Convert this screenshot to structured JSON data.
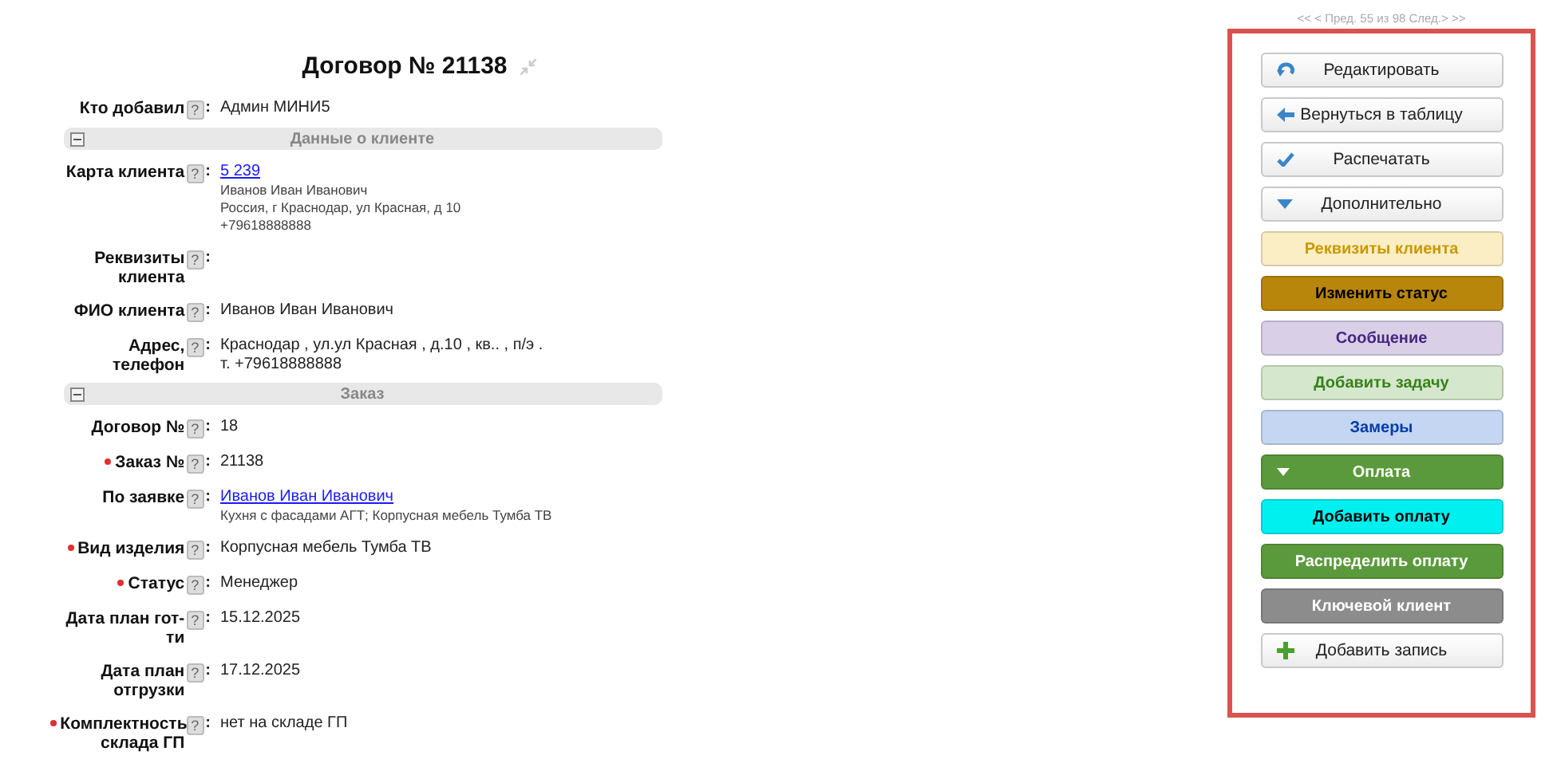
{
  "title": "Договор № 21138",
  "pager": "<< < Пред. 55 из 98 След.> >>",
  "items": [
    {
      "kind": "field",
      "label": "Кто добавил",
      "required": false,
      "help": "?",
      "colon": ":",
      "link": false,
      "lines": [
        "Админ МИНИ5"
      ]
    },
    {
      "kind": "section",
      "title": "Данные о клиенте",
      "expanded": true
    },
    {
      "kind": "field",
      "label": "Карта клиента",
      "required": false,
      "help": "?",
      "colon": ":",
      "link": true,
      "lines": [
        "5 239"
      ],
      "details": [
        "Иванов Иван Иванович",
        "Россия, г Краснодар, ул Красная, д 10",
        "+79618888888"
      ]
    },
    {
      "kind": "field",
      "label": "Реквизиты клиента",
      "required": false,
      "help": "?",
      "colon": ":"
    },
    {
      "kind": "field",
      "label": "ФИО клиента",
      "required": false,
      "help": "?",
      "colon": ":",
      "link": false,
      "lines": [
        "Иванов Иван Иванович"
      ]
    },
    {
      "kind": "field",
      "label": "Адрес, телефон",
      "required": false,
      "help": "?",
      "colon": ":",
      "link": false,
      "lines": [
        "Краснодар , ул.ул Красная , д.10 , кв.. , п/э .",
        "т. +79618888888"
      ]
    },
    {
      "kind": "section",
      "title": "Заказ",
      "expanded": true
    },
    {
      "kind": "field",
      "label": "Договор №",
      "required": false,
      "help": "?",
      "colon": ":",
      "link": false,
      "lines": [
        "18"
      ]
    },
    {
      "kind": "field",
      "label": "Заказ №",
      "required": true,
      "help": "?",
      "colon": ":",
      "link": false,
      "lines": [
        "21138"
      ]
    },
    {
      "kind": "field",
      "label": "По заявке",
      "required": false,
      "help": "?",
      "colon": ":",
      "link": true,
      "lines": [
        "Иванов Иван Иванович"
      ],
      "details": [
        "Кухня с фасадами АГТ; Корпусная мебель Тумба ТВ"
      ]
    },
    {
      "kind": "field",
      "label": "Вид изделия",
      "required": true,
      "help": "?",
      "colon": ":",
      "link": false,
      "lines": [
        "Корпусная мебель Тумба ТВ"
      ]
    },
    {
      "kind": "field",
      "label": "Статус",
      "required": true,
      "help": "?",
      "colon": ":",
      "link": false,
      "lines": [
        "Менеджер"
      ]
    },
    {
      "kind": "field",
      "label": "Дата план гот-ти",
      "required": false,
      "help": "?",
      "colon": ":",
      "link": false,
      "lines": [
        "15.12.2025"
      ]
    },
    {
      "kind": "field",
      "label": "Дата план отгрузки",
      "required": false,
      "help": "?",
      "colon": ":",
      "link": false,
      "lines": [
        "17.12.2025"
      ]
    },
    {
      "kind": "field",
      "label": "Комплектность склада ГП",
      "required": true,
      "help": "?",
      "colon": ":",
      "link": false,
      "lines": [
        "нет на складе ГП"
      ]
    }
  ],
  "buttons": [
    {
      "kind": "edit",
      "label": "Редактировать"
    },
    {
      "kind": "back",
      "label": "Вернуться в таблицу"
    },
    {
      "kind": "check",
      "label": "Распечатать"
    },
    {
      "kind": "more",
      "label": "Дополнительно"
    },
    {
      "kind": "pastel",
      "label": "Реквизиты клиента",
      "color": "#fbeec4"
    },
    {
      "kind": "dark_text",
      "label": "Изменить статус",
      "color": "#b8860b"
    },
    {
      "kind": "pastel",
      "label": "Сообщение",
      "color": "#d9d0e8"
    },
    {
      "kind": "pastel",
      "label": "Добавить задачу",
      "color": "#d5e8cd"
    },
    {
      "kind": "pastel",
      "label": "Замеры",
      "color": "#c4d6f2"
    },
    {
      "kind": "toggle",
      "label": "Оплата",
      "color": "#5b9a3c"
    },
    {
      "kind": "dark_text",
      "label": "Добавить оплату",
      "color": "#00f0f0"
    },
    {
      "kind": "light_text",
      "label": "Распределить оплату",
      "color": "#5b9a3c"
    },
    {
      "kind": "light_text",
      "label": "Ключевой клиент",
      "color": "#8c8c8c"
    },
    {
      "kind": "add",
      "label": "Добавить запись"
    }
  ]
}
